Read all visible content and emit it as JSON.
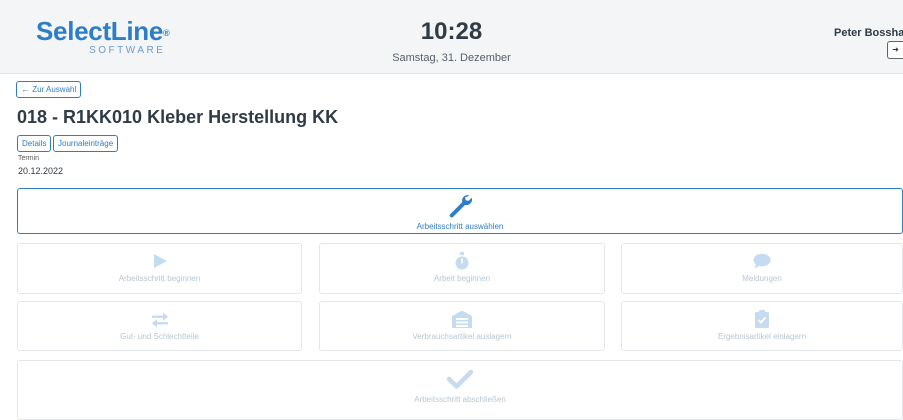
{
  "header": {
    "logo_main": "SelectLine",
    "logo_reg": "®",
    "logo_sub": "SOFTWARE",
    "time": "10:28",
    "date": "Samstag, 31. Dezember",
    "user": "Peter Bosshard"
  },
  "nav": {
    "back_label": "Zur Auswahl"
  },
  "page": {
    "title": "018 - R1KK010 Kleber Herstellung KK",
    "tabs": [
      "Details",
      "Journaleinträge"
    ],
    "termin_label": "Termin",
    "termin_value": "20.12.2022"
  },
  "actions": {
    "select_step": "Arbeitsschritt auswählen",
    "begin_step": "Arbeitsschritt beginnen",
    "begin_work": "Arbeit beginnen",
    "messages": "Meldungen",
    "good_bad_parts": "Gut- und Schlechtteile",
    "consume_items": "Verbrauchsartikel auslagern",
    "store_result": "Ergebnisartikel einlagern",
    "finish_step": "Arbeitsschritt abschließen"
  },
  "colors": {
    "accent": "#2d7ec4",
    "disabled_icon": "#c5dcf0",
    "disabled_text": "#b9c6d2"
  },
  "icons": {
    "select_step": "wrench-icon",
    "begin_step": "play-icon",
    "begin_work": "stopwatch-icon",
    "messages": "speech-bubble-icon",
    "good_bad_parts": "exchange-arrows-icon",
    "consume_items": "warehouse-icon",
    "store_result": "clipboard-check-icon",
    "finish_step": "checkmark-icon"
  }
}
